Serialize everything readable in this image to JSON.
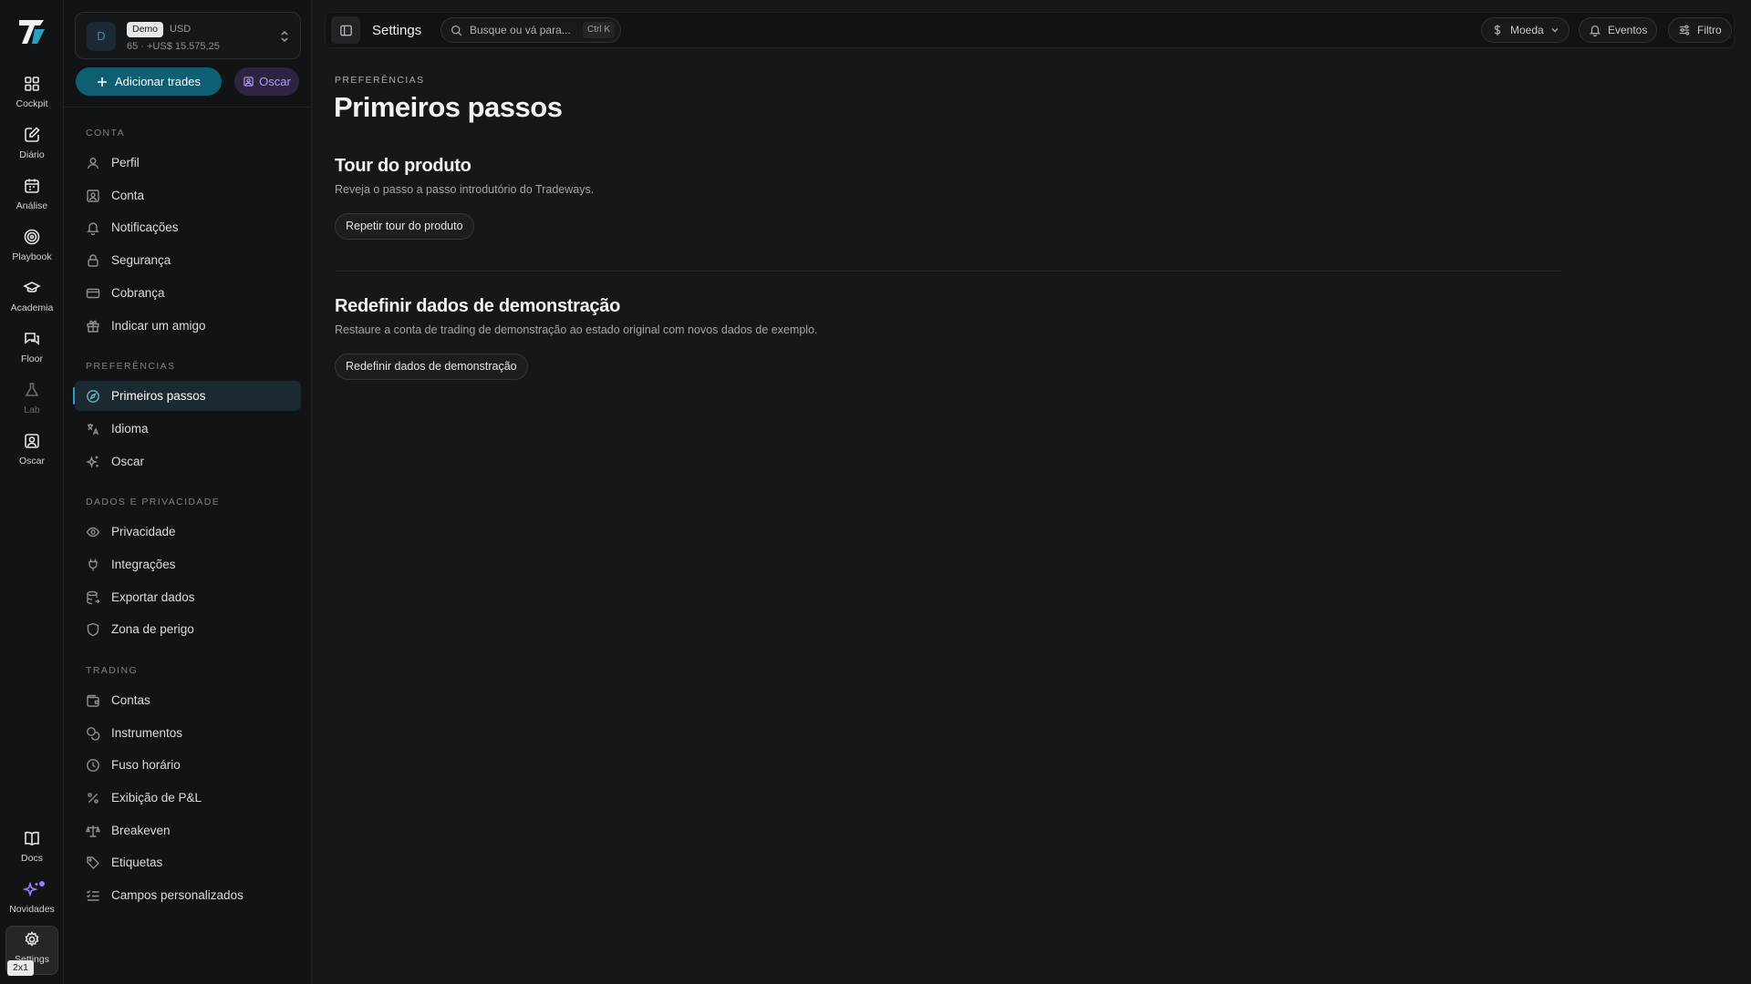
{
  "rail": {
    "items": [
      {
        "label": "Cockpit",
        "icon": "grid-icon"
      },
      {
        "label": "Diário",
        "icon": "journal-edit-icon"
      },
      {
        "label": "Análise",
        "icon": "calendar-icon"
      },
      {
        "label": "Playbook",
        "icon": "target-icon"
      },
      {
        "label": "Academia",
        "icon": "graduation-cap-icon"
      },
      {
        "label": "Floor",
        "icon": "chat-bubbles-icon"
      },
      {
        "label": "Lab",
        "icon": "flask-icon"
      },
      {
        "label": "Oscar",
        "icon": "user-square-icon"
      }
    ],
    "bottom": [
      {
        "label": "Docs",
        "icon": "book-icon"
      },
      {
        "label": "Novidades",
        "icon": "sparkles-icon"
      },
      {
        "label": "Settings",
        "icon": "gear-icon"
      }
    ],
    "badge": "2x1"
  },
  "account": {
    "avatar": "D",
    "badge": "Demo",
    "currency": "USD",
    "summary": "65 · +US$ 15.575,25"
  },
  "actions": {
    "add_trades": "Adicionar trades",
    "oscar": "Oscar"
  },
  "sidebar": {
    "sections": [
      {
        "title": "CONTA",
        "items": [
          "Perfil",
          "Conta",
          "Notificações",
          "Segurança",
          "Cobrança",
          "Indicar um amigo"
        ]
      },
      {
        "title": "PREFERÊNCIAS",
        "items": [
          "Primeiros passos",
          "Idioma",
          "Oscar"
        ]
      },
      {
        "title": "DADOS E PRIVACIDADE",
        "items": [
          "Privacidade",
          "Integrações",
          "Exportar dados",
          "Zona de perigo"
        ]
      },
      {
        "title": "TRADING",
        "items": [
          "Contas",
          "Instrumentos",
          "Fuso horário",
          "Exibição de P&L",
          "Breakeven",
          "Etiquetas",
          "Campos personalizados"
        ]
      }
    ]
  },
  "topbar": {
    "title": "Settings",
    "search_placeholder": "Busque ou vá para...",
    "shortcut": "Ctrl K",
    "currency_btn": "Moeda",
    "events_btn": "Eventos",
    "filter_btn": "Filtro"
  },
  "main": {
    "eyebrow": "PREFERÊNCIAS",
    "title": "Primeiros passos",
    "tour": {
      "title": "Tour do produto",
      "description": "Reveja o passo a passo introdutório do Tradeways.",
      "button": "Repetir tour do produto"
    },
    "reset": {
      "title": "Redefinir dados de demonstração",
      "description": "Restaure a conta de trading de demonstração ao estado original com novos dados de exemplo.",
      "button": "Redefinir dados de demonstração"
    }
  },
  "colors": {
    "accent": "#0f5f73",
    "oscar_accent": "#b69bff",
    "background": "#161719"
  }
}
